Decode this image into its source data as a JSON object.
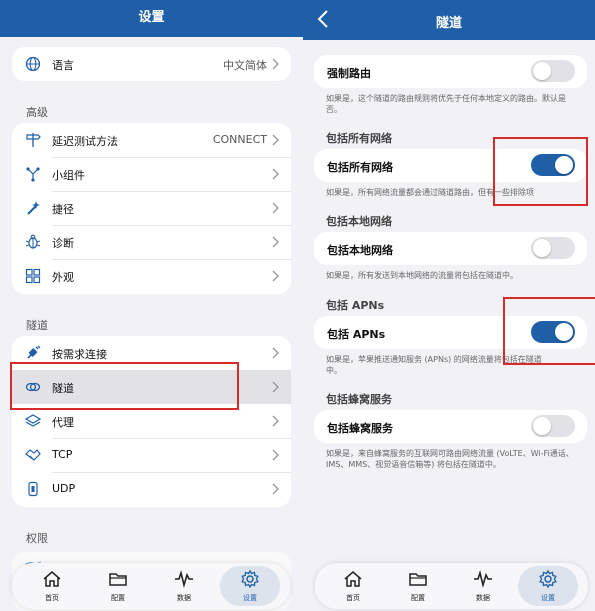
{
  "left": {
    "title": "设置",
    "language": {
      "label": "语言",
      "value": "中文简体"
    },
    "section_advanced": "高级",
    "advanced_items": [
      {
        "label": "延迟测试方法",
        "value": "CONNECT"
      },
      {
        "label": "小组件",
        "value": ""
      },
      {
        "label": "捷径",
        "value": ""
      },
      {
        "label": "诊断",
        "value": ""
      },
      {
        "label": "外观",
        "value": ""
      }
    ],
    "section_tunnel": "隧道",
    "tunnel_items": [
      {
        "label": "按需求连接"
      },
      {
        "label": "隧道"
      },
      {
        "label": "代理"
      },
      {
        "label": "TCP"
      },
      {
        "label": "UDP"
      }
    ],
    "section_permissions": "权限",
    "partial_item": {
      "label": "位置",
      "value": "开启"
    },
    "highlight_color": "#d42b2b"
  },
  "right": {
    "title": "隧道",
    "force_route": {
      "label": "强制路由",
      "on": false,
      "note": "如果是，这个隧道的路由规则将优先于任何本地定义的路由。默认是否。"
    },
    "sec_all": "包括所有网络",
    "include_all": {
      "label": "包括所有网络",
      "on": true,
      "note": "如果是，所有网络流量都会通过隧道路由，但有一些排除项"
    },
    "sec_local": "包括本地网络",
    "include_local": {
      "label": "包括本地网络",
      "on": false,
      "note": "如果是，所有发送到本地网络的流量将包括在隧道中。"
    },
    "sec_apns": "包括 APNs",
    "include_apns": {
      "label": "包括 APNs",
      "on": true,
      "note": "如果是，苹果推送通知服务 (APNs) 的网络流量将包括在隧道中。"
    },
    "sec_cellular": "包括蜂窝服务",
    "include_cellular": {
      "label": "包括蜂窝服务",
      "on": false,
      "note": "如果是，来自蜂窝服务的互联网可路由网络流量 (VoLTE、Wi-Fi通话、IMS、MMS、视觉语音信箱等) 将包括在隧道中。"
    }
  },
  "tabs": [
    "首页",
    "配置",
    "数据",
    "设置"
  ],
  "colors": {
    "accent": "#1f5fa8",
    "toggle_on": "#1f5fa8",
    "toggle_off": "#e1e1e6"
  }
}
